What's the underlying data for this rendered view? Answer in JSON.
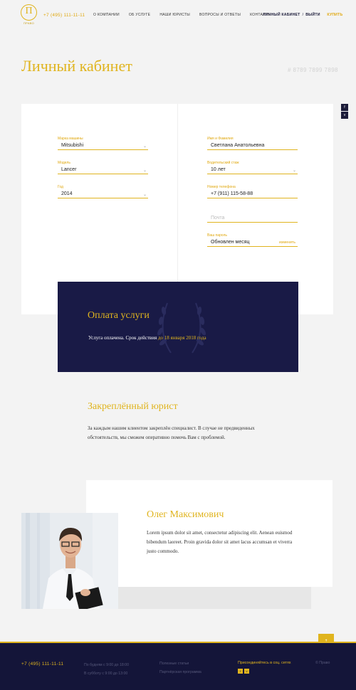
{
  "header": {
    "logo_letter": "П",
    "logo_caption": "ПРАВО",
    "phone": "+7 (495) 111-11-11",
    "nav": [
      "О компании",
      "Об услуге",
      "Наши юристы",
      "Вопросы и ответы",
      "Контакты"
    ],
    "account_label": "Личный кабинет",
    "separator": "/",
    "logout_label": "Выйти",
    "buy_label": "Купить"
  },
  "page": {
    "title": "Личный кабинет",
    "account_number": "# 8789 7899 7898"
  },
  "side_icons": [
    "facebook-icon",
    "vk-icon"
  ],
  "form": {
    "left": [
      {
        "label": "Марка машины",
        "value": "Mitsubishi",
        "type": "select"
      },
      {
        "label": "Модель",
        "value": "Lancer",
        "type": "select"
      },
      {
        "label": "Год",
        "value": "2014",
        "type": "select"
      }
    ],
    "right": [
      {
        "label": "Имя и Фамилия",
        "value": "Светлана Анатольевна"
      },
      {
        "label": "Водительский стаж",
        "value": "10 лет",
        "type": "select"
      },
      {
        "label": "Номер телефона",
        "value": "+7 (911) 115-58-88"
      },
      {
        "label": "",
        "value": "",
        "placeholder": "Почта"
      },
      {
        "label": "Ваш пароль",
        "value": "Обновлен месяц",
        "action": "изменить"
      }
    ]
  },
  "payment": {
    "title": "Оплата услуги",
    "text": "Услуга оплачена. Срок действия ",
    "highlight": "до 18 января 2018 года"
  },
  "lawyer_section": {
    "title": "Закреплённый юрист",
    "text": "За каждым нашим клиентом закреплён специалист. В случае не предвиденных обстоятельств, мы сможем оперативно помочь Вам с проблемой."
  },
  "lawyer": {
    "name": "Олег Максимович",
    "bio": "Lorem ipsum dolor sit amet, consectetur adipiscing elit. Aenean euismod bibendum laoreet. Proin gravida dolor sit amet lacus accumsan et viverra justo commodo."
  },
  "footer": {
    "phone": "+7 (495) 111-11-11",
    "schedule": [
      "По будням с 9:00 до 18:00",
      "В субботу с 9:00 до 13:00"
    ],
    "links": [
      "Полезные статьи",
      "Партнёрская программа"
    ],
    "join": "Присоединяйтесь в соц. сетях",
    "copyright": "© Право"
  },
  "colors": {
    "accent": "#e0b41e",
    "navy": "#191a46",
    "background": "#f3f3f3"
  }
}
